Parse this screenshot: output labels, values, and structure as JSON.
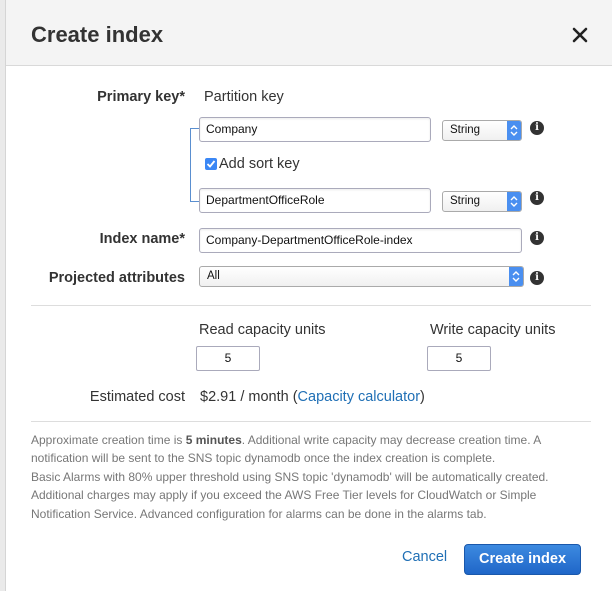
{
  "dialog": {
    "title": "Create index",
    "close_icon": "close-icon"
  },
  "primary_key": {
    "label": "Primary key*",
    "partition_label": "Partition key",
    "partition_value": "Company",
    "partition_type": "String",
    "add_sort_label": "Add sort key",
    "add_sort_checked": true,
    "sort_value": "DepartmentOfficeRole",
    "sort_type": "String"
  },
  "index_name": {
    "label": "Index name*",
    "value": "Company-DepartmentOfficeRole-index"
  },
  "projected": {
    "label": "Projected attributes",
    "value": "All"
  },
  "capacity": {
    "read_label": "Read capacity units",
    "read_value": "5",
    "write_label": "Write capacity units",
    "write_value": "5"
  },
  "cost": {
    "label": "Estimated cost",
    "value": "$2.91 / month (",
    "link": "Capacity calculator",
    "close_paren": ")"
  },
  "note": {
    "part1": "Approximate creation time is ",
    "bold": "5 minutes",
    "part2": ". Additional write capacity may decrease creation time. A notification will be sent to the SNS topic dynamodb once the index creation is complete.",
    "line2": "Basic Alarms with 80% upper threshold using SNS topic 'dynamodb' will be automatically created. Additional charges may apply if you exceed the AWS Free Tier levels for CloudWatch or Simple Notification Service. Advanced configuration for alarms can be done in the alarms tab."
  },
  "footer": {
    "cancel": "Cancel",
    "create": "Create index"
  },
  "colors": {
    "primary_button": "#2b78d8",
    "link": "#1f6fb5",
    "checkbox": "#3b87f5"
  }
}
